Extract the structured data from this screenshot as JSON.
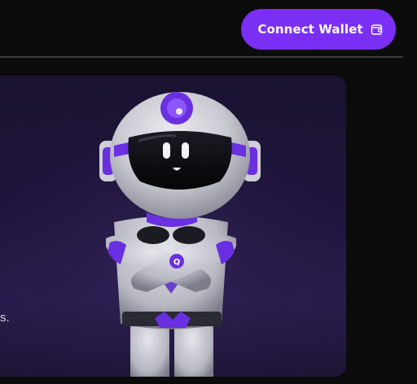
{
  "header": {
    "connect_wallet_label": "Connect Wallet"
  },
  "hero": {
    "partial_text": "s."
  },
  "colors": {
    "accent": "#7b2ff5",
    "background": "#0b0b0b",
    "hero_bg": "#1f153c"
  },
  "icons": {
    "wallet": "wallet-icon"
  }
}
